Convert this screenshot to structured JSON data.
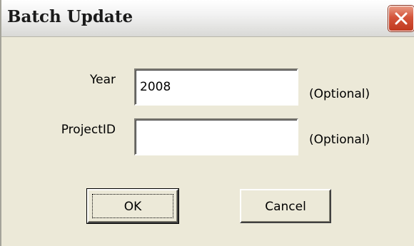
{
  "window": {
    "title": "Batch Update",
    "close_icon": "close-x-icon",
    "close_color": "#d4543a"
  },
  "form": {
    "year_label": "Year",
    "year_value": "2008",
    "year_hint": "(Optional)",
    "project_label": "ProjectID",
    "project_value": "",
    "project_hint": "(Optional)"
  },
  "buttons": {
    "ok_label": "OK",
    "cancel_label": "Cancel"
  }
}
